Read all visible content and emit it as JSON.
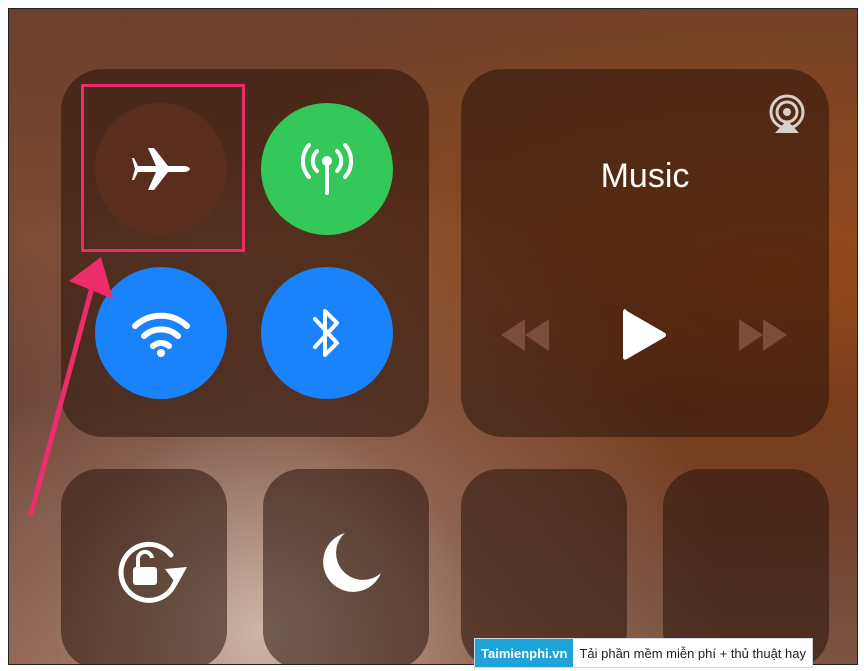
{
  "control_center": {
    "music": {
      "title": "Music"
    },
    "connectivity": {
      "airplane_mode": "airplane-icon",
      "cellular": "cellular-icon",
      "wifi": "wifi-icon",
      "bluetooth": "bluetooth-icon"
    },
    "colors": {
      "cellular_on": "#34c759",
      "wifi_on": "#1a82fb",
      "bluetooth_on": "#1a82fb",
      "highlight": "#ec2d6a"
    }
  },
  "watermark": {
    "brand": "Taimienphi.vn",
    "tagline": "Tải phần mềm miễn phí + thủ thuật hay"
  }
}
